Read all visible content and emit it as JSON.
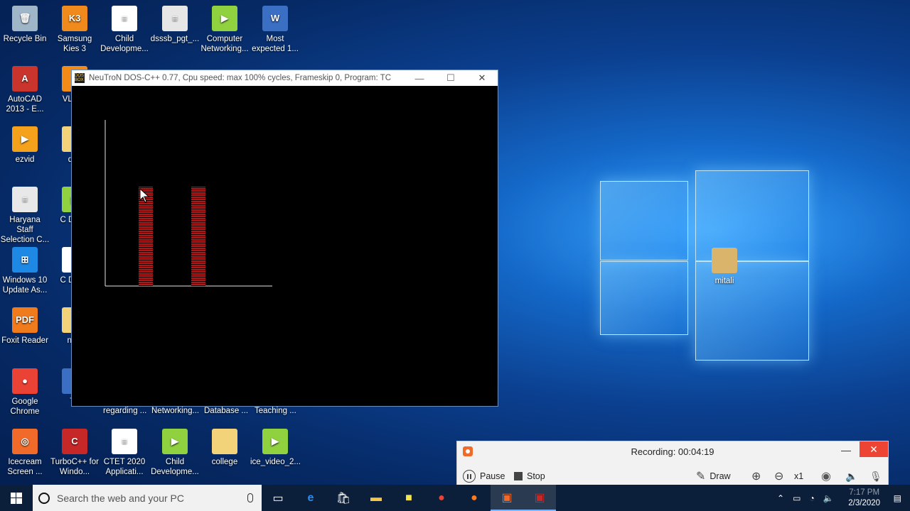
{
  "desktop": {
    "icons": [
      {
        "label": "Recycle Bin",
        "glyph": "🗑",
        "color": "#9fb6c9"
      },
      {
        "label": "Samsung Kies 3",
        "glyph": "K3",
        "color": "#f08a1c"
      },
      {
        "label": "Child Developme...",
        "glyph": "≡",
        "color": "#ffffff"
      },
      {
        "label": "dsssb_pgt_...",
        "glyph": "≡",
        "color": "#e6e6e6"
      },
      {
        "label": "Computer Networking...",
        "glyph": "▶",
        "color": "#8fd13f"
      },
      {
        "label": "Most expected 1...",
        "glyph": "W",
        "color": "#3b6fc4"
      },
      {
        "label": "AutoCAD 2013 - E...",
        "glyph": "A",
        "color": "#c9352c"
      },
      {
        "label": "VLC pl",
        "glyph": "▲",
        "color": "#f28a17"
      },
      {
        "label": "ezvid",
        "glyph": "▶",
        "color": "#f4a21c"
      },
      {
        "label": "des",
        "glyph": "",
        "color": "#f3d37a"
      },
      {
        "label": "Haryana Staff Selection C...",
        "glyph": "≡",
        "color": "#e8e8e8"
      },
      {
        "label": "C Devel",
        "glyph": "▶",
        "color": "#8fd13f"
      },
      {
        "label": "Windows 10 Update As...",
        "glyph": "⊞",
        "color": "#1e88e5"
      },
      {
        "label": "C Devel",
        "glyph": "",
        "color": "#ffffff"
      },
      {
        "label": "Foxit Reader",
        "glyph": "PDF",
        "color": "#f07b1d"
      },
      {
        "label": "new",
        "glyph": "",
        "color": "#f3d37a"
      },
      {
        "label": "Google Chrome",
        "glyph": "●",
        "color": "#ea4335"
      },
      {
        "label": "Th",
        "glyph": "",
        "color": "#3b6fc4"
      },
      {
        "label": "Icecream Screen ...",
        "glyph": "◎",
        "color": "#f06a2a"
      },
      {
        "label": "TurboC++ for Windo...",
        "glyph": "C",
        "color": "#c62828"
      },
      {
        "label": "CTET 2020 Applicati...",
        "glyph": "≡",
        "color": "#ffffff"
      },
      {
        "label": "Child Developme...",
        "glyph": "▶",
        "color": "#8fd13f"
      },
      {
        "label": "college",
        "glyph": "",
        "color": "#f3d37a"
      },
      {
        "label": "ice_video_2...",
        "glyph": "▶",
        "color": "#8fd13f"
      },
      {
        "label": "mitali",
        "glyph": "",
        "color": "#d9b46a"
      }
    ],
    "partial_labels": [
      "regarding ...",
      "Networking...",
      "Database ...",
      "Teaching ..."
    ]
  },
  "dos_window": {
    "title": "NeuTroN DOS-C++ 0.77, Cpu speed: max 100% cycles, Frameskip  0, Program:     TC",
    "app_icon_text": "DOS BOX"
  },
  "recorder": {
    "status": "Recording:  00:04:19",
    "pause_label": "Pause",
    "stop_label": "Stop",
    "draw_label": "Draw",
    "zoom_label": "x1"
  },
  "taskbar": {
    "search_placeholder": "Search the web and your PC",
    "time": "7:17 PM",
    "date": "2/3/2020"
  },
  "colors": {
    "bar_red": "#b01818",
    "recorder_accent": "#f06a2a"
  }
}
